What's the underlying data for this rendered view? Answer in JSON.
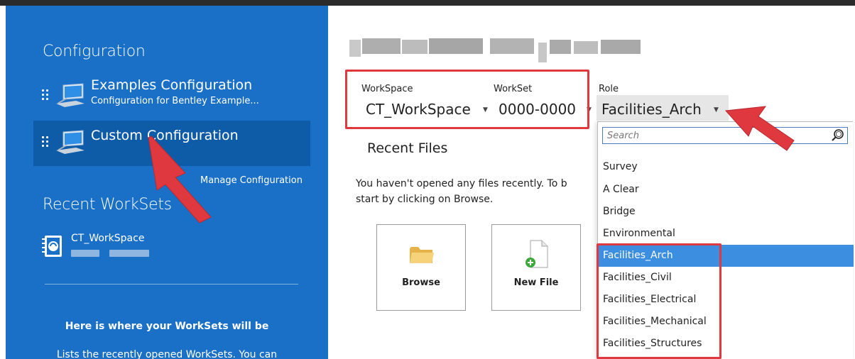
{
  "sidebar": {
    "configuration_heading": "Configuration",
    "configurations": [
      {
        "title": "Examples Configuration",
        "subtitle": "Configuration for Bentley Example..."
      },
      {
        "title": "Custom Configuration",
        "subtitle": ""
      }
    ],
    "manage_link": "Manage Configuration",
    "recent_worksets_heading": "Recent WorkSets",
    "recent_worksets": [
      {
        "name": "CT_WorkSpace"
      }
    ],
    "hint_title": "Here is where your WorkSets will be",
    "hint_body": "Lists the recently opened WorkSets. You can"
  },
  "main": {
    "selectors": {
      "workspace_label": "WorkSpace",
      "workspace_value": "CT_WorkSpace",
      "workset_label": "WorkSet",
      "workset_value": "0000-0000",
      "role_label": "Role",
      "role_value": "Facilities_Arch"
    },
    "recent_files_heading": "Recent Files",
    "recent_files_msg_line1": "You haven't opened any files recently.  To b",
    "recent_files_msg_line2": "start by clicking on Browse.",
    "tiles": {
      "browse_label": "Browse",
      "new_file_label": "New File"
    }
  },
  "role_dropdown": {
    "search_placeholder": "Search",
    "options": [
      "Survey",
      "A Clear",
      "Bridge",
      "Environmental",
      "Facilities_Arch",
      "Facilities_Civil",
      "Facilities_Electrical",
      "Facilities_Mechanical",
      "Facilities_Structures"
    ],
    "selected": "Facilities_Arch"
  },
  "colors": {
    "sidebar_bg": "#1a70c6",
    "selected_item_bg": "#0e5ba8",
    "highlight_red": "#e0383f",
    "selected_option_bg": "#3c8ee0"
  }
}
